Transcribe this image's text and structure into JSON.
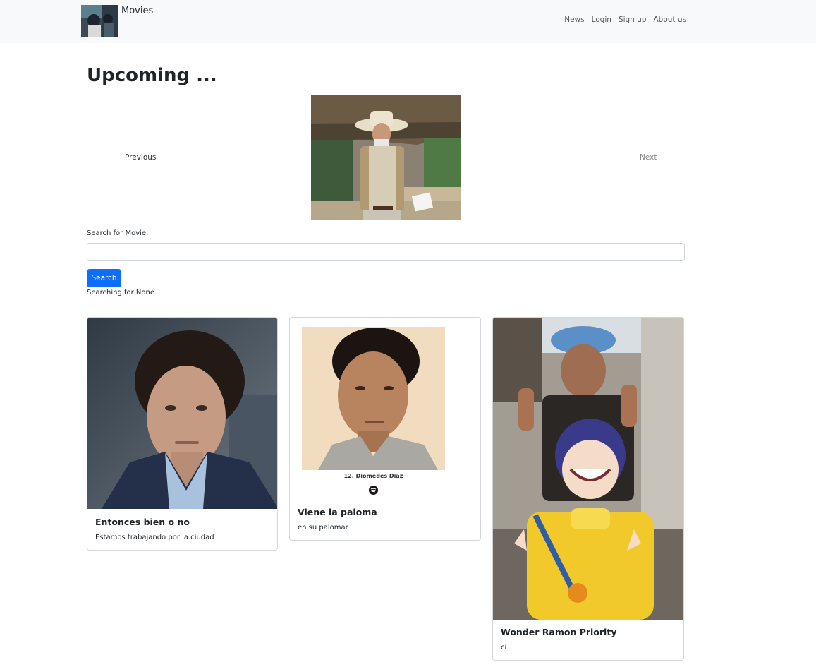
{
  "navbar": {
    "brand": "Movies",
    "links": [
      "News",
      "Login",
      "Sign up",
      "About us"
    ]
  },
  "page": {
    "heading": "Upcoming ..."
  },
  "carousel": {
    "prev_label": "Previous",
    "next_label": "Next"
  },
  "search": {
    "label": "Search for Movie:",
    "value": "",
    "button": "Search",
    "status": "Searching for None"
  },
  "cards": [
    {
      "title": "Entonces bien o no",
      "text": "Estamos trabajando por la ciudad"
    },
    {
      "title": "Viene la paloma",
      "text": "en su palomar",
      "image_caption": "12. Diomedes Diaz"
    },
    {
      "title": "Wonder Ramon Priority",
      "text": "ci"
    }
  ],
  "colors": {
    "navbar_bg": "#f8f9fa",
    "primary": "#0d6efd",
    "card_border": "#d3d6d9"
  },
  "icons": [
    "spotify-icon"
  ]
}
